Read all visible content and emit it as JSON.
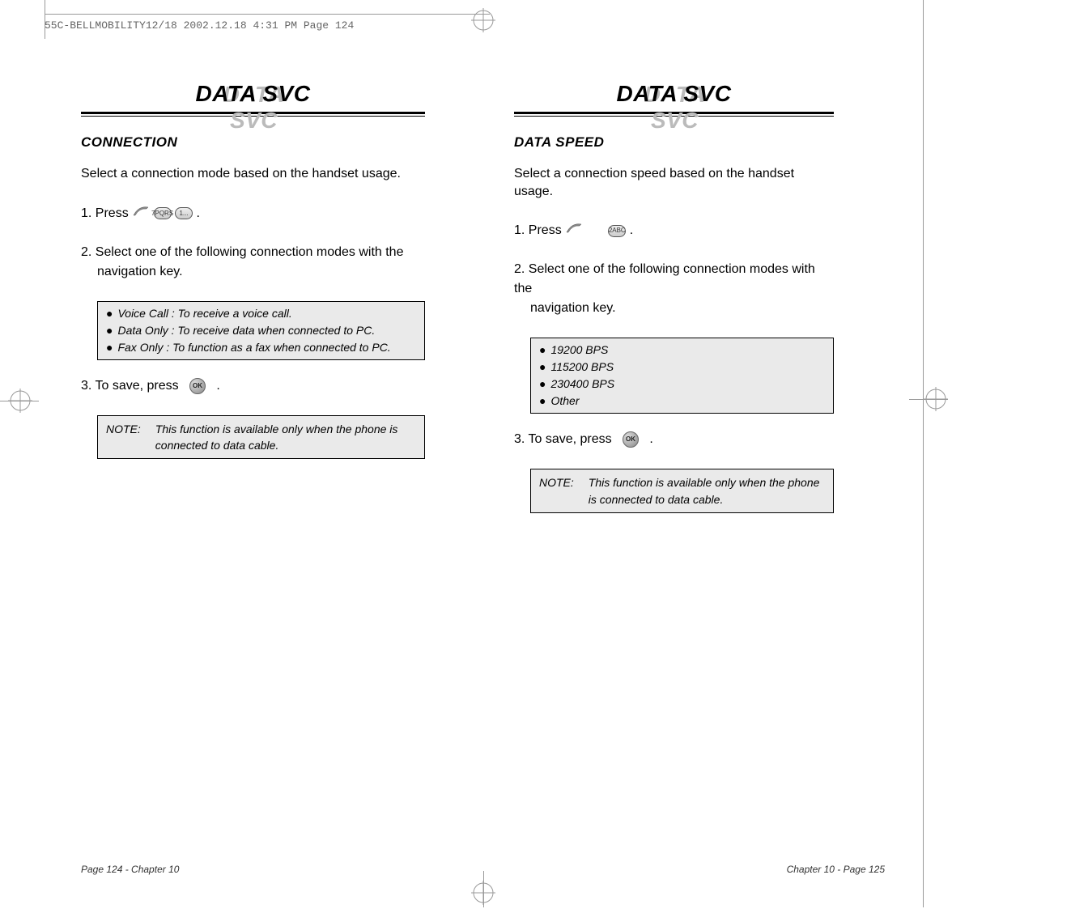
{
  "header": {
    "slug": "55C-BELLMOBILITY12/18  2002.12.18  4:31 PM  Page 124"
  },
  "left_page": {
    "section_title": "DATA SVC",
    "subheading": "CONNECTION",
    "intro": "Select a connection mode based on the handset usage.",
    "step1_pre": "1. Press",
    "step1_post": ".",
    "step2": "2. Select one of the following connection modes with the",
    "step2_cont": "navigation key.",
    "options": [
      "Voice Call : To receive a voice call.",
      "Data Only : To receive data when connected to PC.",
      "Fax Only : To function as a fax when connected to PC."
    ],
    "step3_pre": "3. To save, press",
    "step3_post": ".",
    "note_label": "NOTE:",
    "note_text": "This function is available only when the phone is connected to data cable.",
    "footer": "Page 124 - Chapter 10",
    "keys": {
      "k7": "7PQRS",
      "k1": "1..."
    }
  },
  "right_page": {
    "section_title": "DATA SVC",
    "subheading": "DATA SPEED",
    "intro": "Select a connection speed based on the handset usage.",
    "step1_pre": "1. Press",
    "step1_post": ".",
    "step2": "2. Select one of the following connection modes with the",
    "step2_cont": "navigation key.",
    "options": [
      "19200 BPS",
      "115200 BPS",
      "230400 BPS",
      "Other"
    ],
    "step3_pre": "3. To save, press",
    "step3_post": ".",
    "note_label": "NOTE:",
    "note_text": "This function is available only when the phone is connected to data cable.",
    "footer": "Chapter 10 - Page 125",
    "keys": {
      "k2": "2ABC"
    }
  },
  "icons": {
    "ok": "OK"
  }
}
